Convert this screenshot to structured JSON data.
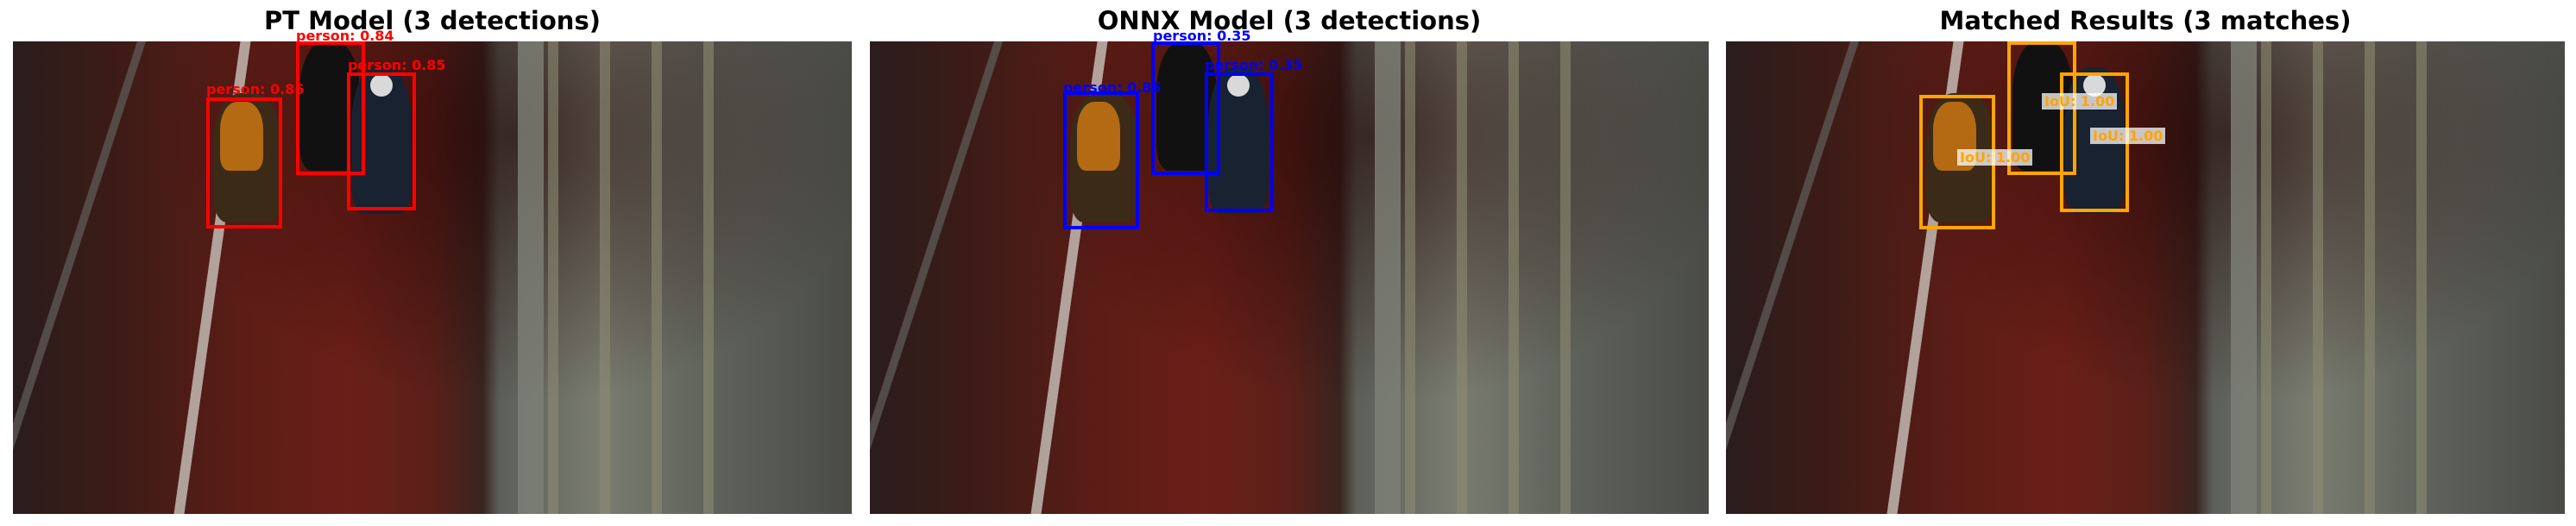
{
  "panels": [
    {
      "title": "PT Model (3 detections)",
      "labels": [
        "person: 0.86",
        "person: 0.84",
        "person: 0.85"
      ]
    },
    {
      "title": "ONNX Model (3 detections)",
      "labels": [
        "person: 0.86",
        "person: 0.35",
        "person: 0.35"
      ]
    },
    {
      "title": "Matched Results (3 matches)",
      "labels": [
        "IoU: 1.00",
        "IoU: 1.00",
        "IoU: 1.00"
      ]
    }
  ],
  "colors": {
    "pt_box": "#ff0000",
    "onnx_box": "#0000ff",
    "match_box": "#ffa500"
  }
}
